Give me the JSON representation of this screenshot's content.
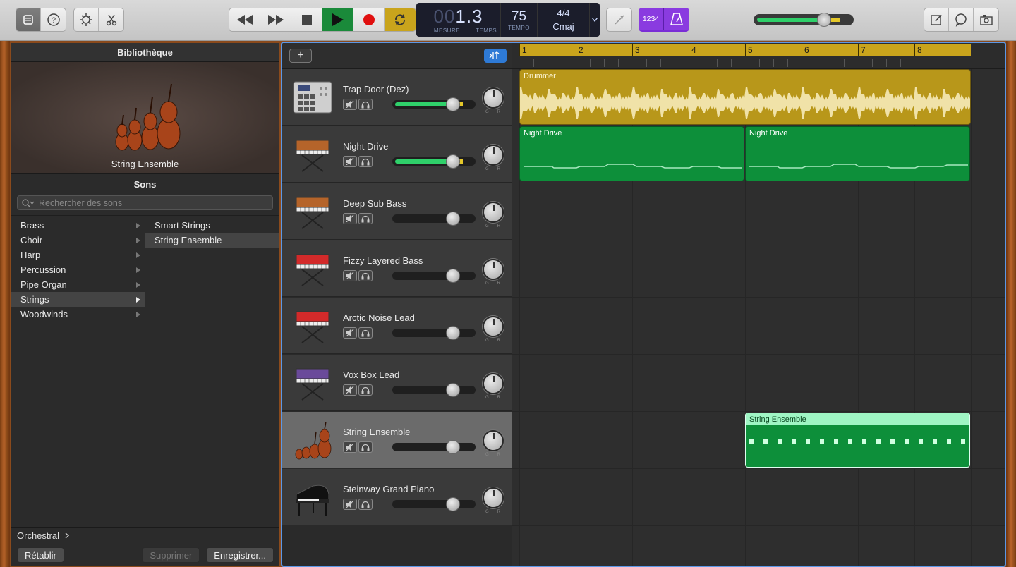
{
  "toolbar": {
    "transport_position": {
      "dim": "00",
      "value": "1.3",
      "label_bar": "MESURE",
      "label_beat": "TEMPS"
    },
    "tempo": {
      "value": "75",
      "label": "TEMPO"
    },
    "signature": "4/4",
    "key": "Cmaj",
    "count_in_label": "1234",
    "master_volume": 0.68
  },
  "library": {
    "title": "Bibliothèque",
    "selected_patch": "String Ensemble",
    "sounds_title": "Sons",
    "search_placeholder": "Rechercher des sons",
    "categories": [
      {
        "label": "Brass"
      },
      {
        "label": "Choir"
      },
      {
        "label": "Harp"
      },
      {
        "label": "Percussion"
      },
      {
        "label": "Pipe Organ"
      },
      {
        "label": "Strings"
      },
      {
        "label": "Woodwinds"
      }
    ],
    "selected_category": "Strings",
    "patches": [
      {
        "label": "Smart Strings"
      },
      {
        "label": "String Ensemble"
      }
    ],
    "breadcrumb": "Orchestral",
    "buttons": {
      "revert": "Rétablir",
      "delete": "Supprimer",
      "save": "Enregistrer..."
    }
  },
  "tracks": [
    {
      "name": "Trap Door (Dez)",
      "volume": 0.73,
      "active_meter": true
    },
    {
      "name": "Night Drive",
      "volume": 0.73,
      "active_meter": true
    },
    {
      "name": "Deep Sub Bass",
      "volume": 0.73,
      "active_meter": false
    },
    {
      "name": "Fizzy Layered Bass",
      "volume": 0.73,
      "active_meter": false
    },
    {
      "name": "Arctic Noise Lead",
      "volume": 0.73,
      "active_meter": false
    },
    {
      "name": "Vox Box Lead",
      "volume": 0.73,
      "active_meter": false
    },
    {
      "name": "String Ensemble",
      "volume": 0.73,
      "active_meter": false,
      "selected": true
    },
    {
      "name": "Steinway Grand Piano",
      "volume": 0.73,
      "active_meter": false
    }
  ],
  "timeline": {
    "bars": [
      "1",
      "2",
      "3",
      "4",
      "5",
      "6",
      "7",
      "8"
    ],
    "regions": {
      "drummer": "Drummer",
      "night_drive_1": "Night Drive",
      "night_drive_2": "Night Drive",
      "string_ensemble": "String Ensemble"
    }
  },
  "colors": {
    "drummer_region": "#b8971a",
    "synth_region": "#0d8f3a",
    "selection_blue": "#5b97e6",
    "play_green": "#1a8a3a",
    "record_red": "#e01010",
    "cycle_yellow": "#c9a41c"
  }
}
